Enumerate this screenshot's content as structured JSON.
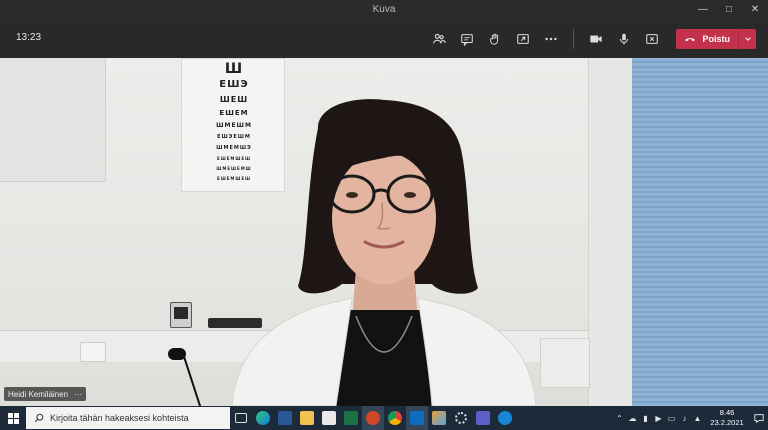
{
  "window": {
    "title": "Kuva"
  },
  "call": {
    "timer": "13:23",
    "leave_label": "Poistu",
    "leave_color": "#c4314b",
    "toolbar_icons": [
      "participants-icon",
      "chat-icon",
      "raise-hand-icon",
      "share-icon",
      "more-icon",
      "camera-icon",
      "microphone-icon",
      "share-tray-icon"
    ]
  },
  "participant": {
    "name": "Heidi Kemiläinen",
    "more": "···"
  },
  "eye_chart": {
    "rows": [
      "Ш",
      "ЕШЭ",
      "ШЕШ",
      "ЕШЕМ",
      "ШМЕШМ",
      "ЕШЭЕШМ",
      "ШМЕМШЭ",
      "ЕШЕМШЕШ",
      "ШМЕШЕМШ",
      "ЕШЕМШЕШ"
    ]
  },
  "taskbar": {
    "search_placeholder": "Kirjoita tähän hakeaksesi kohteista",
    "time": "8.46",
    "date": "23.2.2021",
    "apps": [
      "task-view",
      "edge",
      "word",
      "file-explorer",
      "store",
      "excel",
      "powerpoint",
      "chrome",
      "outlook",
      "paint",
      "settings",
      "teams",
      "help"
    ]
  }
}
